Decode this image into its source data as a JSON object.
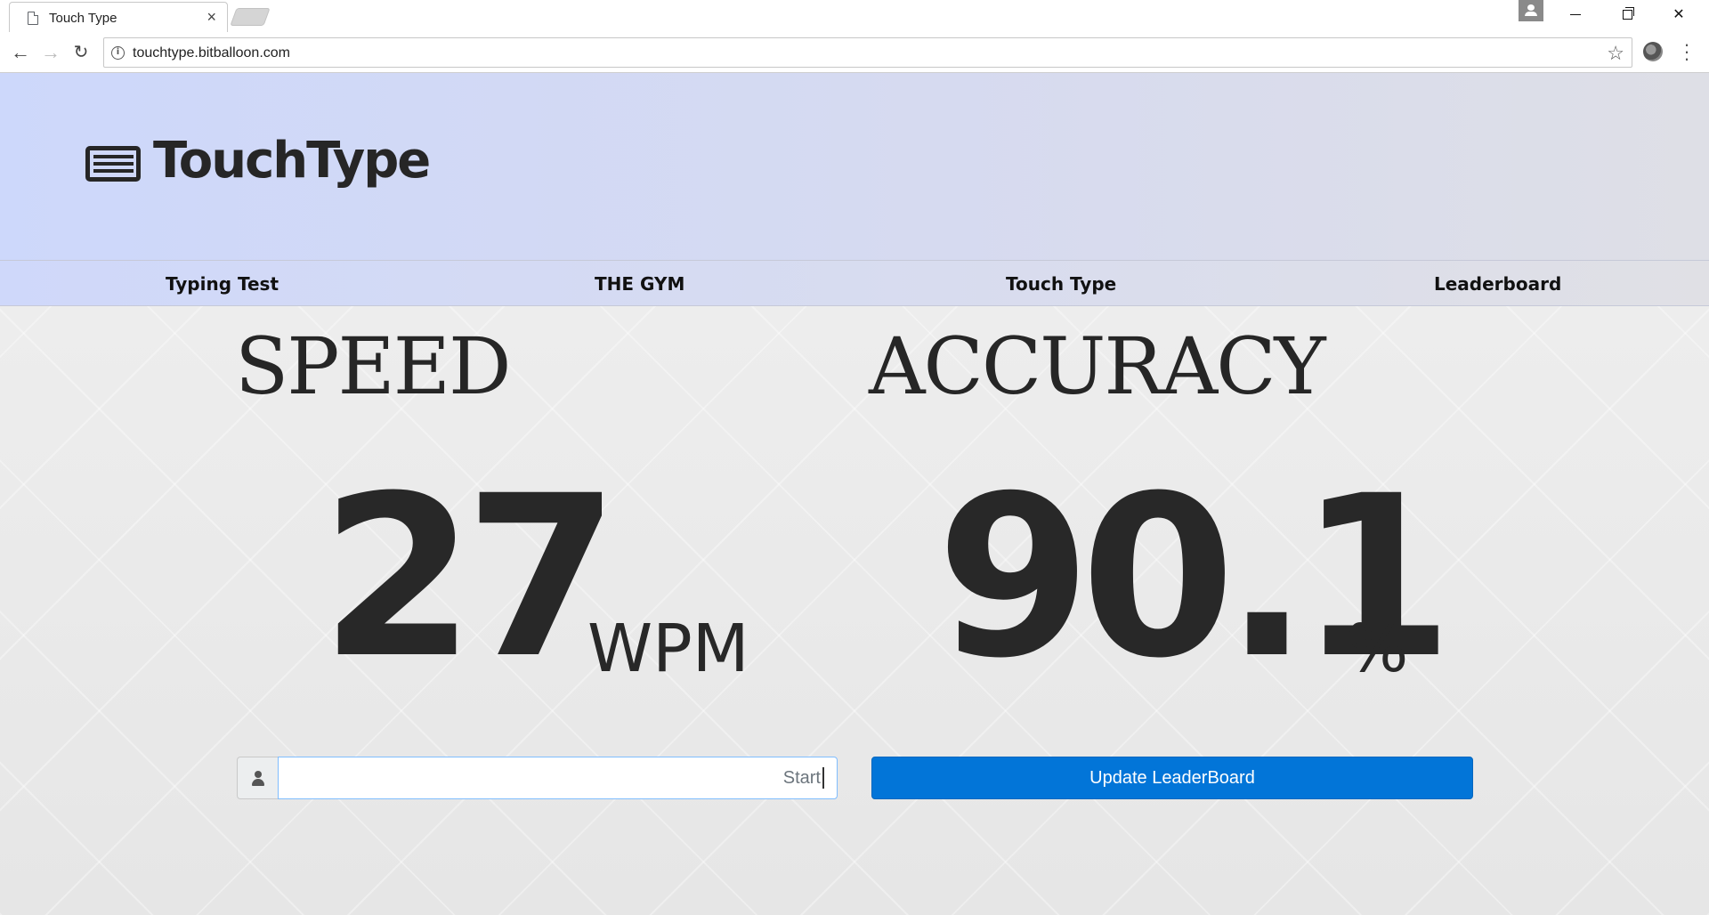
{
  "browser": {
    "tab_title": "Touch Type",
    "tab_close": "×",
    "url": "touchtype.bitballoon.com",
    "icons": [
      "page-icon",
      "back-arrow-icon",
      "forward-arrow-icon",
      "reload-icon",
      "info-icon",
      "star-icon",
      "extension-icon",
      "menu-icon",
      "profile-icon"
    ]
  },
  "header": {
    "logo_text": "TouchType",
    "logo_icon": "keyboard-icon"
  },
  "nav": {
    "items": [
      {
        "label": "Typing Test"
      },
      {
        "label": "THE GYM"
      },
      {
        "label": "Touch Type"
      },
      {
        "label": "Leaderboard"
      }
    ]
  },
  "stats": {
    "speed_label": "SPEED",
    "speed_value": "27",
    "speed_unit": "WPM",
    "accuracy_label": "ACCURACY",
    "accuracy_value": "90.1",
    "accuracy_unit": "%"
  },
  "form": {
    "name_placeholder": "Start",
    "name_value": "",
    "update_button": "Update LeaderBoard"
  },
  "colors": {
    "header_gradient_start": "#cdd8fb",
    "primary_button": "#0275d8",
    "text_dark": "#282828"
  }
}
